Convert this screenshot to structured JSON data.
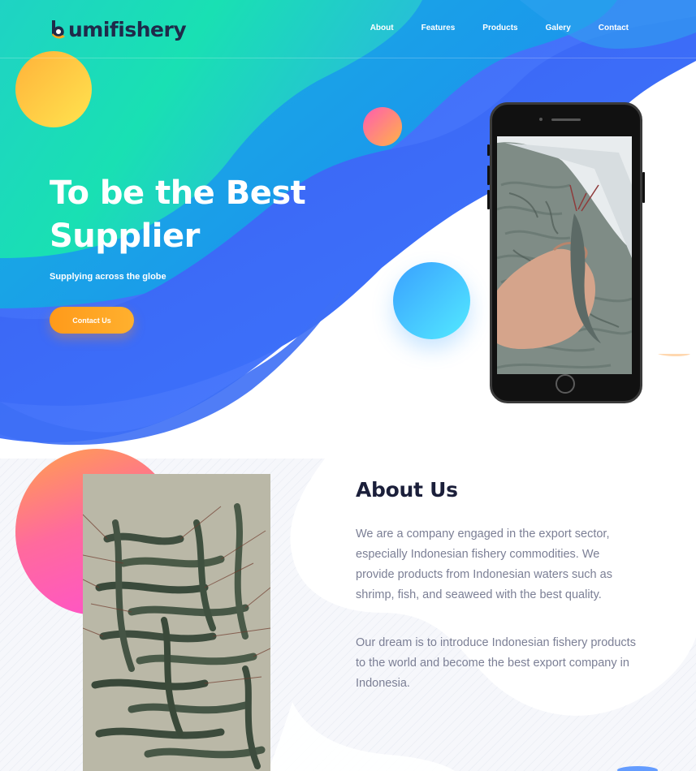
{
  "brand": {
    "name": "umifishery",
    "mark": "b"
  },
  "nav": {
    "items": [
      "About",
      "Features",
      "Products",
      "Galery",
      "Contact"
    ]
  },
  "hero": {
    "title": "To be the Best Supplier",
    "subtitle": "Supplying across the globe",
    "cta": "Contact Us"
  },
  "about": {
    "title": "About Us",
    "paragraph1": "We are a company engaged in the export sector, especially Indonesian fishery commodities. We provide products from Indonesian waters such as shrimp, fish, and seaweed with the best quality.",
    "paragraph2": "Our dream is to introduce Indonesian fishery products to the world and become the best export company in Indonesia."
  },
  "colors": {
    "wave_green": "#1ee0b4",
    "wave_blue": "#3a6cf4",
    "wave_cyan": "#1ab4e6",
    "cta_orange": "#ff9a1a",
    "heading_dark": "#1b1f3a",
    "body_gray": "#7b7f95"
  }
}
